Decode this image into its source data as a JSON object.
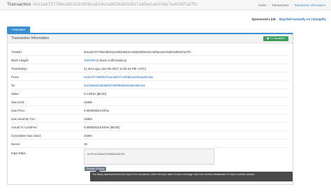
{
  "header": {
    "title": "Transaction",
    "hash": "0x11a672776bcd81911c508ca914e1ab5263b01617a6fae1ae10da7ed0167a27fc",
    "breadcrumbs": [
      "Home",
      "Transactions",
      "Transaction Information"
    ]
  },
  "sponsored": {
    "label": "Sponsored Link:",
    "link_text": "Buy/Sell Instantly on Changelly"
  },
  "tab": {
    "label": "Overview"
  },
  "panel": {
    "title": "Transaction Information",
    "visualizer_button": "Tx Visualizer"
  },
  "fields": [
    {
      "label": "TxHash:",
      "value": "0x11a672776bcd81911c508ca914e1ab5263b01617a6fae1ae10da7ed0167a27fc",
      "link": false
    },
    {
      "label": "Block Height:",
      "value": "1064808",
      "extra": " (2 block confirmations)",
      "link": true
    },
    {
      "label": "TimeStamp:",
      "value": "41 secs ago (Jun-05-2017 11:53:44 PM +UTC)",
      "link": false
    },
    {
      "label": "From:",
      "value": "0xa9cd77999f3d7aaea8647ce80f56a2e84aad6c55e",
      "link": true
    },
    {
      "label": "To:",
      "value": "0x1fd6b5b03d369faf7689f950bb0295cb6bc63",
      "link": true
    },
    {
      "label": "Value:",
      "value": "0.1 Ether ($0.00)",
      "link": false
    },
    {
      "label": "Gas Limit:",
      "value": "21685",
      "link": false
    },
    {
      "label": "Gas Price:",
      "value": "0.000000024 Ether",
      "link": false
    },
    {
      "label": "Gas Used By Txn:",
      "value": "21684",
      "link": false
    },
    {
      "label": "Actual Tx Cost/Fee:",
      "value": "0.000525216 Ether ($0.00)",
      "link": false
    },
    {
      "label": "Cumulative Gas Used:",
      "value": "21684",
      "link": false
    },
    {
      "label": "Nonce:",
      "value": "19",
      "link": false
    },
    {
      "label": "Input Data:",
      "value": "",
      "link": false
    }
  ],
  "input_data": {
    "value": "0x537461636b4578636861606765"
  },
  "convert_button": "Convert To Ascii",
  "tooltip": "The binary data that formed the input to the transaction, either the input data if it was a message call or the contract initialisation if it was a contract creation"
}
